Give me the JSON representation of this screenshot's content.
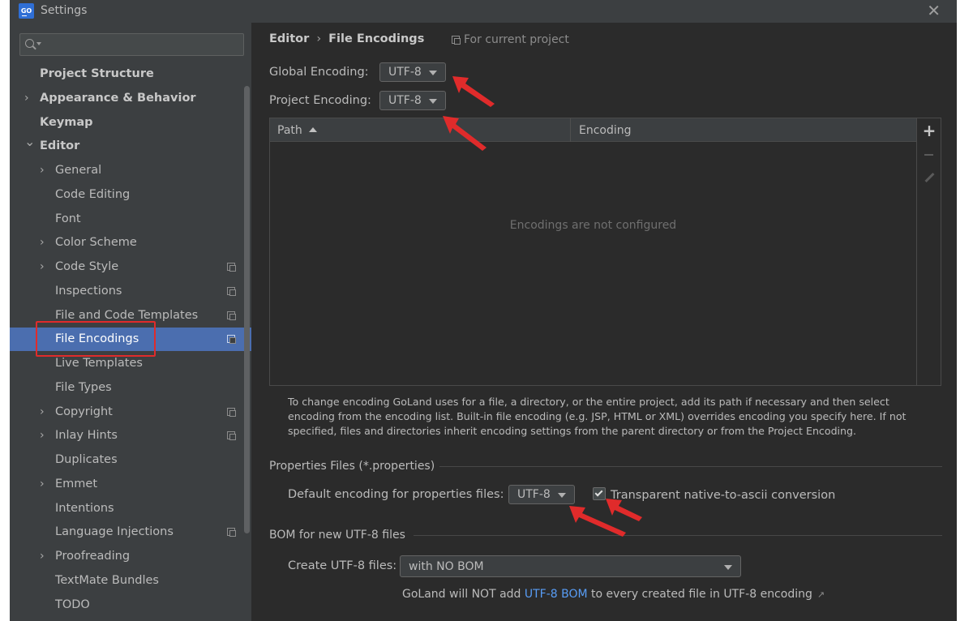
{
  "window": {
    "logo_text": "GO",
    "title": "Settings",
    "close_symbol": "✕"
  },
  "sidebar": {
    "search": {
      "placeholder": "",
      "value": ""
    },
    "items": [
      {
        "label": "Project Structure",
        "level": 0,
        "expandable": false,
        "bold": true,
        "project_scope": false
      },
      {
        "label": "Appearance & Behavior",
        "level": 0,
        "expandable": true,
        "expanded": false,
        "bold": true,
        "project_scope": false
      },
      {
        "label": "Keymap",
        "level": 0,
        "expandable": false,
        "bold": true,
        "project_scope": false
      },
      {
        "label": "Editor",
        "level": 0,
        "expandable": true,
        "expanded": true,
        "bold": true,
        "project_scope": false
      },
      {
        "label": "General",
        "level": 1,
        "expandable": true,
        "expanded": false,
        "project_scope": false
      },
      {
        "label": "Code Editing",
        "level": 1,
        "expandable": false,
        "project_scope": false
      },
      {
        "label": "Font",
        "level": 1,
        "expandable": false,
        "project_scope": false
      },
      {
        "label": "Color Scheme",
        "level": 1,
        "expandable": true,
        "expanded": false,
        "project_scope": false
      },
      {
        "label": "Code Style",
        "level": 1,
        "expandable": true,
        "expanded": false,
        "project_scope": true
      },
      {
        "label": "Inspections",
        "level": 1,
        "expandable": false,
        "project_scope": true
      },
      {
        "label": "File and Code Templates",
        "level": 1,
        "expandable": false,
        "project_scope": true
      },
      {
        "label": "File Encodings",
        "level": 1,
        "expandable": false,
        "project_scope": true,
        "selected": true
      },
      {
        "label": "Live Templates",
        "level": 1,
        "expandable": false,
        "project_scope": false
      },
      {
        "label": "File Types",
        "level": 1,
        "expandable": false,
        "project_scope": false
      },
      {
        "label": "Copyright",
        "level": 1,
        "expandable": true,
        "expanded": false,
        "project_scope": true
      },
      {
        "label": "Inlay Hints",
        "level": 1,
        "expandable": true,
        "expanded": false,
        "project_scope": true
      },
      {
        "label": "Duplicates",
        "level": 1,
        "expandable": false,
        "project_scope": false
      },
      {
        "label": "Emmet",
        "level": 1,
        "expandable": true,
        "expanded": false,
        "project_scope": false
      },
      {
        "label": "Intentions",
        "level": 1,
        "expandable": false,
        "project_scope": false
      },
      {
        "label": "Language Injections",
        "level": 1,
        "expandable": false,
        "project_scope": true
      },
      {
        "label": "Proofreading",
        "level": 1,
        "expandable": true,
        "expanded": false,
        "project_scope": false
      },
      {
        "label": "TextMate Bundles",
        "level": 1,
        "expandable": false,
        "project_scope": false
      },
      {
        "label": "TODO",
        "level": 1,
        "expandable": false,
        "project_scope": false
      }
    ]
  },
  "main": {
    "breadcrumb": {
      "parent": "Editor",
      "separator": "›",
      "current": "File Encodings"
    },
    "scope_hint": "For current project",
    "global_encoding": {
      "label": "Global Encoding:",
      "value": "UTF-8"
    },
    "project_encoding": {
      "label": "Project Encoding:",
      "value": "UTF-8"
    },
    "table": {
      "columns": [
        "Path",
        "Encoding"
      ],
      "sort_column": "Path",
      "sort_direction": "ascending",
      "rows": [],
      "empty_text": "Encodings are not configured",
      "toolbar": {
        "add": "+",
        "remove": "−",
        "edit": "edit"
      }
    },
    "description": "To change encoding GoLand uses for a file, a directory, or the entire project, add its path if necessary and then select encoding from the encoding list. Built-in file encoding (e.g. JSP, HTML or XML) overrides encoding you specify here. If not specified, files and directories inherit encoding settings from the parent directory or from the Project Encoding.",
    "properties_section": {
      "title": "Properties Files (*.properties)",
      "default_encoding_label": "Default encoding for properties files:",
      "default_encoding_value": "UTF-8",
      "native_to_ascii": {
        "label": "Transparent native-to-ascii conversion",
        "checked": true
      }
    },
    "bom_section": {
      "title": "BOM for new UTF-8 files",
      "create_label": "Create UTF-8 files:",
      "create_value": "with NO BOM",
      "note_before": "GoLand will NOT add ",
      "note_link": "UTF-8 BOM",
      "note_after": " to every created file in UTF-8 encoding",
      "note_icon": "↗"
    }
  },
  "colors": {
    "window_bg": "#2b2b2b",
    "sidebar_bg": "#3c3f41",
    "selection": "#4b6eaf",
    "link": "#589df6",
    "annotation_red": "#e02b2b"
  },
  "icons": {
    "search": "search-icon",
    "close": "close-icon",
    "project_scope": "project-scope-icon",
    "chevron": "chevron-right-icon",
    "dropdown": "dropdown-arrow-icon",
    "external_link": "external-link-icon"
  }
}
